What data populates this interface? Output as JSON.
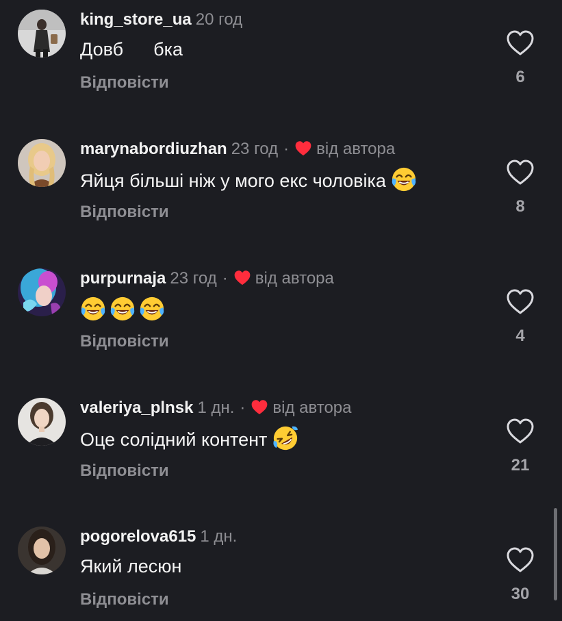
{
  "colors": {
    "background": "#1c1d22",
    "muted": "#8e8e93",
    "heart_red": "#ff2d3d"
  },
  "comments": [
    {
      "username": "king_store_ua",
      "time": "20 год",
      "text_part1": "Довб",
      "text_part2": "бка",
      "liked_by_author": false,
      "reply_label": "Відповісти",
      "like_count": "6"
    },
    {
      "username": "marynabordiuzhan",
      "time": "23 год",
      "separator": "·",
      "author_label": "від автора",
      "text": "Яйця більші ніж у мого екс чоловіка",
      "emoji": "face-with-tears-of-joy",
      "liked_by_author": true,
      "reply_label": "Відповісти",
      "like_count": "8"
    },
    {
      "username": "purpurnaja",
      "time": "23 год",
      "separator": "·",
      "author_label": "від автора",
      "emojis": [
        "face-with-tears-of-joy",
        "face-with-tears-of-joy",
        "face-with-tears-of-joy"
      ],
      "liked_by_author": true,
      "reply_label": "Відповісти",
      "like_count": "4"
    },
    {
      "username": "valeriya_plnsk",
      "time": "1 дн.",
      "separator": "·",
      "author_label": "від автора",
      "text": "Оце солідний контент",
      "emoji": "rolling-on-floor-laughing",
      "liked_by_author": true,
      "reply_label": "Відповісти",
      "like_count": "21"
    },
    {
      "username": "pogorelova615",
      "time": "1 дн.",
      "text": "Який лесюн",
      "liked_by_author": false,
      "reply_label": "Відповісти",
      "like_count": "30"
    }
  ]
}
